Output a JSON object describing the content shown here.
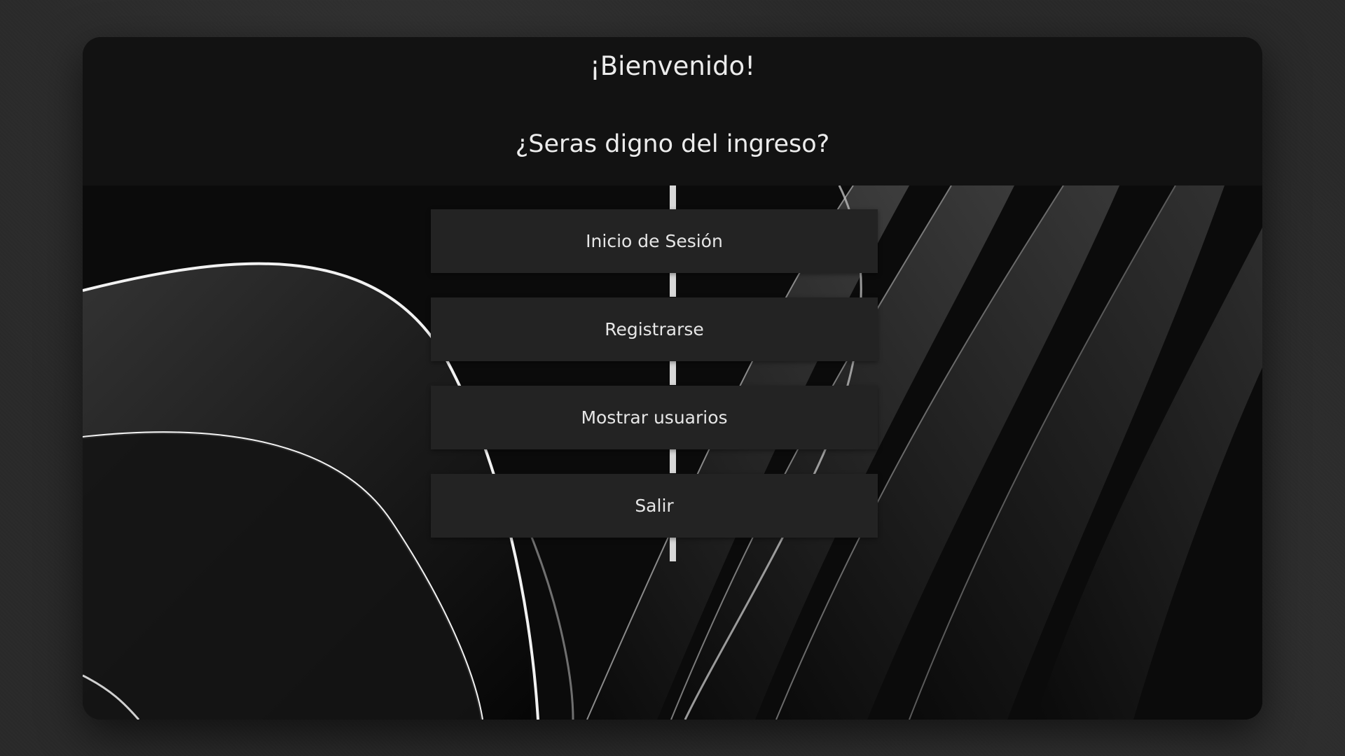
{
  "window": {
    "title": "¡Bienvenido!",
    "subtitle": "¿Seras digno del ingreso?"
  },
  "menu": {
    "buttons": [
      {
        "label": "Inicio de Sesión"
      },
      {
        "label": "Registrarse"
      },
      {
        "label": "Mostrar usuarios"
      },
      {
        "label": "Salir"
      }
    ]
  },
  "colors": {
    "window_background": "#121212",
    "button_background": "#232323",
    "text": "#ececec",
    "connector": "#d8d8d8"
  }
}
